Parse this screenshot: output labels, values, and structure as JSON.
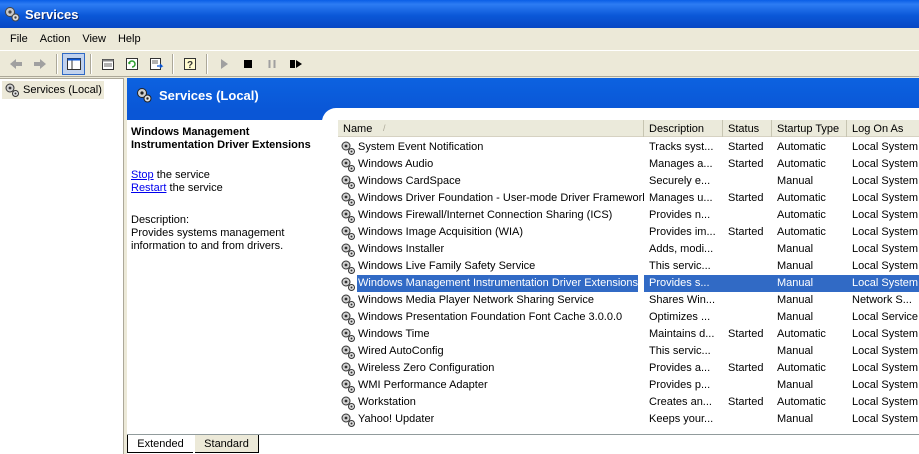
{
  "window": {
    "title": "Services"
  },
  "menu": [
    "File",
    "Action",
    "View",
    "Help"
  ],
  "toolbar": {
    "buttons": [
      "back-icon",
      "forward-icon",
      "show-hide-tree-icon",
      "properties-icon",
      "refresh-icon",
      "export-list-icon",
      "help-icon",
      "start-icon",
      "stop-icon",
      "pause-icon",
      "restart-icon"
    ]
  },
  "tree": {
    "root": "Services (Local)"
  },
  "header": {
    "title": "Services (Local)"
  },
  "description_pane": {
    "title": "Windows Management Instrumentation Driver Extensions",
    "stop_link": "Stop",
    "stop_rest": " the service",
    "restart_link": "Restart",
    "restart_rest": " the service",
    "label": "Description:",
    "text": "Provides systems management information to and from drivers."
  },
  "columns": [
    {
      "label": "Name"
    },
    {
      "label": "Description"
    },
    {
      "label": "Status"
    },
    {
      "label": "Startup Type"
    },
    {
      "label": "Log On As"
    }
  ],
  "rows": [
    {
      "name": "System Event Notification",
      "desc": "Tracks syst...",
      "status": "Started",
      "startup": "Automatic",
      "logon": "Local System"
    },
    {
      "name": "Windows Audio",
      "desc": "Manages a...",
      "status": "Started",
      "startup": "Automatic",
      "logon": "Local System"
    },
    {
      "name": "Windows CardSpace",
      "desc": "Securely e...",
      "status": "",
      "startup": "Manual",
      "logon": "Local System"
    },
    {
      "name": "Windows Driver Foundation - User-mode Driver Framework",
      "desc": "Manages u...",
      "status": "Started",
      "startup": "Automatic",
      "logon": "Local System"
    },
    {
      "name": "Windows Firewall/Internet Connection Sharing (ICS)",
      "desc": "Provides n...",
      "status": "",
      "startup": "Automatic",
      "logon": "Local System"
    },
    {
      "name": "Windows Image Acquisition (WIA)",
      "desc": "Provides im...",
      "status": "Started",
      "startup": "Automatic",
      "logon": "Local System"
    },
    {
      "name": "Windows Installer",
      "desc": "Adds, modi...",
      "status": "",
      "startup": "Manual",
      "logon": "Local System"
    },
    {
      "name": "Windows Live Family Safety Service",
      "desc": "This servic...",
      "status": "",
      "startup": "Manual",
      "logon": "Local System"
    },
    {
      "name": "Windows Management Instrumentation Driver Extensions",
      "desc": "Provides s...",
      "status": "",
      "startup": "Manual",
      "logon": "Local System",
      "selected": true
    },
    {
      "name": "Windows Media Player Network Sharing Service",
      "desc": "Shares Win...",
      "status": "",
      "startup": "Manual",
      "logon": "Network S..."
    },
    {
      "name": "Windows Presentation Foundation Font Cache 3.0.0.0",
      "desc": "Optimizes ...",
      "status": "",
      "startup": "Manual",
      "logon": "Local Service"
    },
    {
      "name": "Windows Time",
      "desc": "Maintains d...",
      "status": "Started",
      "startup": "Automatic",
      "logon": "Local System"
    },
    {
      "name": "Wired AutoConfig",
      "desc": "This servic...",
      "status": "",
      "startup": "Manual",
      "logon": "Local System"
    },
    {
      "name": "Wireless Zero Configuration",
      "desc": "Provides a...",
      "status": "Started",
      "startup": "Automatic",
      "logon": "Local System"
    },
    {
      "name": "WMI Performance Adapter",
      "desc": "Provides p...",
      "status": "",
      "startup": "Manual",
      "logon": "Local System"
    },
    {
      "name": "Workstation",
      "desc": "Creates an...",
      "status": "Started",
      "startup": "Automatic",
      "logon": "Local System"
    },
    {
      "name": "Yahoo! Updater",
      "desc": "Keeps your...",
      "status": "",
      "startup": "Manual",
      "logon": "Local System"
    }
  ],
  "tabs": [
    "Extended",
    "Standard"
  ],
  "colors": {
    "title_bar": "#0a56d6",
    "selection": "#316ac5",
    "link": "#0000ee"
  }
}
